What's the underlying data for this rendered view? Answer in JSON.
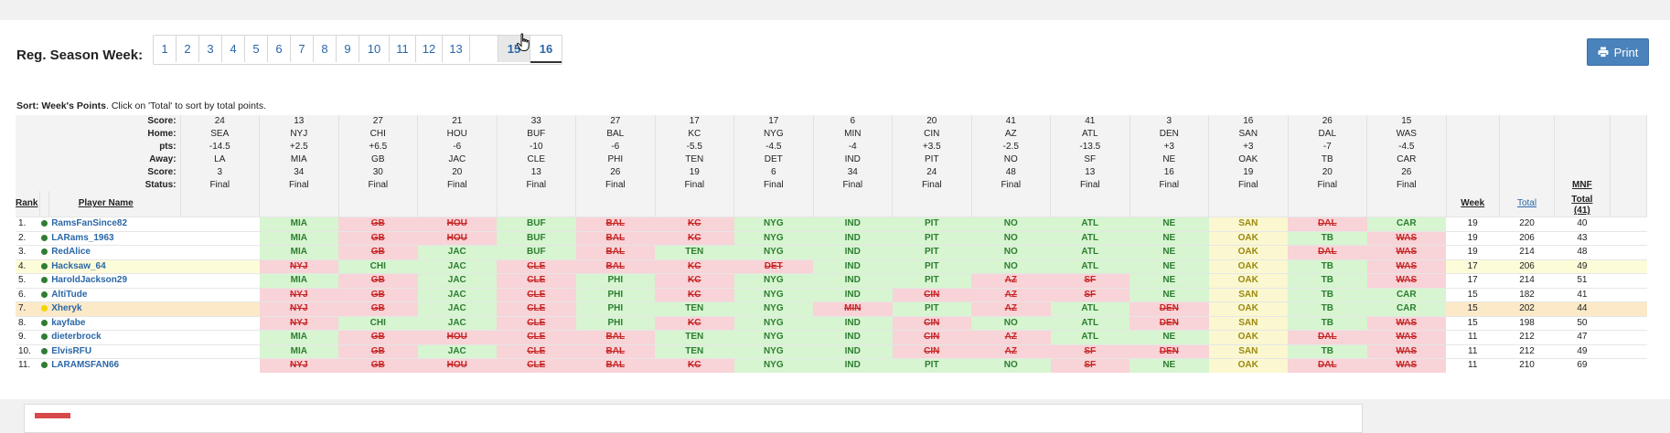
{
  "header": {
    "week_label": "Reg. Season Week:",
    "weeks": [
      "1",
      "2",
      "3",
      "4",
      "5",
      "6",
      "7",
      "8",
      "9",
      "10",
      "11",
      "12",
      "13",
      "",
      "15",
      "16"
    ],
    "active_week": "15",
    "current_week": "16",
    "print_label": "Print"
  },
  "sort_note": {
    "bold": "Sort: Week's Points",
    "rest": ". Click on 'Total' to sort by total points."
  },
  "row_labels": [
    "Score:",
    "Home:",
    "pts:",
    "Away:",
    "Score:",
    "Status:"
  ],
  "games": [
    {
      "home_score": "24",
      "home": "SEA",
      "pts": "-14.5",
      "away": "LA",
      "away_score": "3",
      "status": "Final"
    },
    {
      "home_score": "13",
      "home": "NYJ",
      "pts": "+2.5",
      "away": "MIA",
      "away_score": "34",
      "status": "Final"
    },
    {
      "home_score": "27",
      "home": "CHI",
      "pts": "+6.5",
      "away": "GB",
      "away_score": "30",
      "status": "Final"
    },
    {
      "home_score": "21",
      "home": "HOU",
      "pts": "-6",
      "away": "JAC",
      "away_score": "20",
      "status": "Final"
    },
    {
      "home_score": "33",
      "home": "BUF",
      "pts": "-10",
      "away": "CLE",
      "away_score": "13",
      "status": "Final"
    },
    {
      "home_score": "27",
      "home": "BAL",
      "pts": "-6",
      "away": "PHI",
      "away_score": "26",
      "status": "Final"
    },
    {
      "home_score": "17",
      "home": "KC",
      "pts": "-5.5",
      "away": "TEN",
      "away_score": "19",
      "status": "Final"
    },
    {
      "home_score": "17",
      "home": "NYG",
      "pts": "-4.5",
      "away": "DET",
      "away_score": "6",
      "status": "Final"
    },
    {
      "home_score": "6",
      "home": "MIN",
      "pts": "-4",
      "away": "IND",
      "away_score": "34",
      "status": "Final"
    },
    {
      "home_score": "20",
      "home": "CIN",
      "pts": "+3.5",
      "away": "PIT",
      "away_score": "24",
      "status": "Final"
    },
    {
      "home_score": "41",
      "home": "AZ",
      "pts": "-2.5",
      "away": "NO",
      "away_score": "48",
      "status": "Final"
    },
    {
      "home_score": "41",
      "home": "ATL",
      "pts": "-13.5",
      "away": "SF",
      "away_score": "13",
      "status": "Final"
    },
    {
      "home_score": "3",
      "home": "DEN",
      "pts": "+3",
      "away": "NE",
      "away_score": "16",
      "status": "Final"
    },
    {
      "home_score": "16",
      "home": "SAN",
      "pts": "+3",
      "away": "OAK",
      "away_score": "19",
      "status": "Final"
    },
    {
      "home_score": "26",
      "home": "DAL",
      "pts": "-7",
      "away": "TB",
      "away_score": "20",
      "status": "Final"
    },
    {
      "home_score": "15",
      "home": "WAS",
      "pts": "-4.5",
      "away": "CAR",
      "away_score": "26",
      "status": "Final"
    }
  ],
  "columns": {
    "rank": "Rank",
    "player": "Player Name",
    "week": "Week",
    "total": "Total",
    "mnf_line1": "MNF",
    "mnf_line2": "Total",
    "mnf_line3": "(41)"
  },
  "players": [
    {
      "rank": "1.",
      "name": "RamsFanSince82",
      "status": "green",
      "highlight": "",
      "picks": [
        [
          "",
          ""
        ],
        [
          "MIA",
          "w"
        ],
        [
          "GB",
          "l"
        ],
        [
          "HOU",
          "l"
        ],
        [
          "BUF",
          "w"
        ],
        [
          "BAL",
          "l"
        ],
        [
          "KC",
          "l"
        ],
        [
          "NYG",
          "w"
        ],
        [
          "IND",
          "w"
        ],
        [
          "PIT",
          "w"
        ],
        [
          "NO",
          "w"
        ],
        [
          "ATL",
          "w"
        ],
        [
          "NE",
          "w"
        ],
        [
          "SAN",
          "p"
        ],
        [
          "DAL",
          "l"
        ],
        [
          "CAR",
          "w"
        ]
      ],
      "week": "19",
      "total": "220",
      "mnf": "40"
    },
    {
      "rank": "2.",
      "name": "LARams_1963",
      "status": "green",
      "highlight": "",
      "picks": [
        [
          "",
          ""
        ],
        [
          "MIA",
          "w"
        ],
        [
          "GB",
          "l"
        ],
        [
          "HOU",
          "l"
        ],
        [
          "BUF",
          "w"
        ],
        [
          "BAL",
          "l"
        ],
        [
          "KC",
          "l"
        ],
        [
          "NYG",
          "w"
        ],
        [
          "IND",
          "w"
        ],
        [
          "PIT",
          "w"
        ],
        [
          "NO",
          "w"
        ],
        [
          "ATL",
          "w"
        ],
        [
          "NE",
          "w"
        ],
        [
          "OAK",
          "p"
        ],
        [
          "TB",
          "w"
        ],
        [
          "WAS",
          "l"
        ]
      ],
      "week": "19",
      "total": "206",
      "mnf": "43"
    },
    {
      "rank": "3.",
      "name": "RedAlice",
      "status": "green",
      "highlight": "",
      "picks": [
        [
          "",
          ""
        ],
        [
          "MIA",
          "w"
        ],
        [
          "GB",
          "l"
        ],
        [
          "JAC",
          "w"
        ],
        [
          "BUF",
          "w"
        ],
        [
          "BAL",
          "l"
        ],
        [
          "TEN",
          "w"
        ],
        [
          "NYG",
          "w"
        ],
        [
          "IND",
          "w"
        ],
        [
          "PIT",
          "w"
        ],
        [
          "NO",
          "w"
        ],
        [
          "ATL",
          "w"
        ],
        [
          "NE",
          "w"
        ],
        [
          "OAK",
          "p"
        ],
        [
          "DAL",
          "l"
        ],
        [
          "WAS",
          "l"
        ]
      ],
      "week": "19",
      "total": "214",
      "mnf": "48"
    },
    {
      "rank": "4.",
      "name": "Hacksaw_64",
      "status": "green",
      "highlight": "yellow",
      "picks": [
        [
          "",
          ""
        ],
        [
          "NYJ",
          "l"
        ],
        [
          "CHI",
          "w"
        ],
        [
          "JAC",
          "w"
        ],
        [
          "CLE",
          "l"
        ],
        [
          "BAL",
          "l"
        ],
        [
          "KC",
          "l"
        ],
        [
          "DET",
          "l"
        ],
        [
          "IND",
          "w"
        ],
        [
          "PIT",
          "w"
        ],
        [
          "NO",
          "w"
        ],
        [
          "ATL",
          "w"
        ],
        [
          "NE",
          "w"
        ],
        [
          "OAK",
          "p"
        ],
        [
          "TB",
          "w"
        ],
        [
          "WAS",
          "l"
        ]
      ],
      "week": "17",
      "total": "206",
      "mnf": "49"
    },
    {
      "rank": "5.",
      "name": "HaroldJackson29",
      "status": "green",
      "highlight": "",
      "picks": [
        [
          "",
          ""
        ],
        [
          "MIA",
          "w"
        ],
        [
          "GB",
          "l"
        ],
        [
          "JAC",
          "w"
        ],
        [
          "CLE",
          "l"
        ],
        [
          "PHI",
          "w"
        ],
        [
          "KC",
          "l"
        ],
        [
          "NYG",
          "w"
        ],
        [
          "IND",
          "w"
        ],
        [
          "PIT",
          "w"
        ],
        [
          "AZ",
          "l"
        ],
        [
          "SF",
          "l"
        ],
        [
          "NE",
          "w"
        ],
        [
          "OAK",
          "p"
        ],
        [
          "TB",
          "w"
        ],
        [
          "WAS",
          "l"
        ]
      ],
      "week": "17",
      "total": "214",
      "mnf": "51"
    },
    {
      "rank": "6.",
      "name": "AltiTude",
      "status": "green",
      "highlight": "",
      "picks": [
        [
          "",
          ""
        ],
        [
          "NYJ",
          "l"
        ],
        [
          "GB",
          "l"
        ],
        [
          "JAC",
          "w"
        ],
        [
          "CLE",
          "l"
        ],
        [
          "PHI",
          "w"
        ],
        [
          "KC",
          "l"
        ],
        [
          "NYG",
          "w"
        ],
        [
          "IND",
          "w"
        ],
        [
          "CIN",
          "l"
        ],
        [
          "AZ",
          "l"
        ],
        [
          "SF",
          "l"
        ],
        [
          "NE",
          "w"
        ],
        [
          "SAN",
          "p"
        ],
        [
          "TB",
          "w"
        ],
        [
          "CAR",
          "w"
        ]
      ],
      "week": "15",
      "total": "182",
      "mnf": "41"
    },
    {
      "rank": "7.",
      "name": "Xheryk",
      "status": "yellow",
      "highlight": "orange",
      "picks": [
        [
          "",
          ""
        ],
        [
          "NYJ",
          "l"
        ],
        [
          "GB",
          "l"
        ],
        [
          "JAC",
          "w"
        ],
        [
          "CLE",
          "l"
        ],
        [
          "PHI",
          "w"
        ],
        [
          "TEN",
          "w"
        ],
        [
          "NYG",
          "w"
        ],
        [
          "MIN",
          "l"
        ],
        [
          "PIT",
          "w"
        ],
        [
          "AZ",
          "l"
        ],
        [
          "ATL",
          "w"
        ],
        [
          "DEN",
          "l"
        ],
        [
          "OAK",
          "p"
        ],
        [
          "TB",
          "w"
        ],
        [
          "CAR",
          "w"
        ]
      ],
      "week": "15",
      "total": "202",
      "mnf": "44"
    },
    {
      "rank": "8.",
      "name": "kayfabe",
      "status": "green",
      "highlight": "",
      "picks": [
        [
          "",
          ""
        ],
        [
          "NYJ",
          "l"
        ],
        [
          "CHI",
          "w"
        ],
        [
          "JAC",
          "w"
        ],
        [
          "CLE",
          "l"
        ],
        [
          "PHI",
          "w"
        ],
        [
          "KC",
          "l"
        ],
        [
          "NYG",
          "w"
        ],
        [
          "IND",
          "w"
        ],
        [
          "CIN",
          "l"
        ],
        [
          "NO",
          "w"
        ],
        [
          "ATL",
          "w"
        ],
        [
          "DEN",
          "l"
        ],
        [
          "SAN",
          "p"
        ],
        [
          "TB",
          "w"
        ],
        [
          "WAS",
          "l"
        ]
      ],
      "week": "15",
      "total": "198",
      "mnf": "50"
    },
    {
      "rank": "9.",
      "name": "dieterbrock",
      "status": "green",
      "highlight": "",
      "picks": [
        [
          "",
          ""
        ],
        [
          "MIA",
          "w"
        ],
        [
          "GB",
          "l"
        ],
        [
          "HOU",
          "l"
        ],
        [
          "CLE",
          "l"
        ],
        [
          "BAL",
          "l"
        ],
        [
          "TEN",
          "w"
        ],
        [
          "NYG",
          "w"
        ],
        [
          "IND",
          "w"
        ],
        [
          "CIN",
          "l"
        ],
        [
          "AZ",
          "l"
        ],
        [
          "ATL",
          "w"
        ],
        [
          "NE",
          "w"
        ],
        [
          "OAK",
          "p"
        ],
        [
          "DAL",
          "l"
        ],
        [
          "WAS",
          "l"
        ]
      ],
      "week": "11",
      "total": "212",
      "mnf": "47"
    },
    {
      "rank": "10.",
      "name": "ElvisRFU",
      "status": "green",
      "highlight": "",
      "picks": [
        [
          "",
          ""
        ],
        [
          "MIA",
          "w"
        ],
        [
          "GB",
          "l"
        ],
        [
          "JAC",
          "w"
        ],
        [
          "CLE",
          "l"
        ],
        [
          "BAL",
          "l"
        ],
        [
          "TEN",
          "w"
        ],
        [
          "NYG",
          "w"
        ],
        [
          "IND",
          "w"
        ],
        [
          "CIN",
          "l"
        ],
        [
          "AZ",
          "l"
        ],
        [
          "SF",
          "l"
        ],
        [
          "DEN",
          "l"
        ],
        [
          "SAN",
          "p"
        ],
        [
          "TB",
          "w"
        ],
        [
          "WAS",
          "l"
        ]
      ],
      "week": "11",
      "total": "212",
      "mnf": "49"
    },
    {
      "rank": "11.",
      "name": "LARAMSFAN66",
      "status": "green",
      "highlight": "",
      "picks": [
        [
          "",
          ""
        ],
        [
          "NYJ",
          "l"
        ],
        [
          "GB",
          "l"
        ],
        [
          "HOU",
          "l"
        ],
        [
          "CLE",
          "l"
        ],
        [
          "BAL",
          "l"
        ],
        [
          "KC",
          "l"
        ],
        [
          "NYG",
          "w"
        ],
        [
          "IND",
          "w"
        ],
        [
          "PIT",
          "w"
        ],
        [
          "NO",
          "w"
        ],
        [
          "SF",
          "l"
        ],
        [
          "NE",
          "w"
        ],
        [
          "OAK",
          "p"
        ],
        [
          "DAL",
          "l"
        ],
        [
          "WAS",
          "l"
        ]
      ],
      "week": "11",
      "total": "210",
      "mnf": "69"
    }
  ]
}
